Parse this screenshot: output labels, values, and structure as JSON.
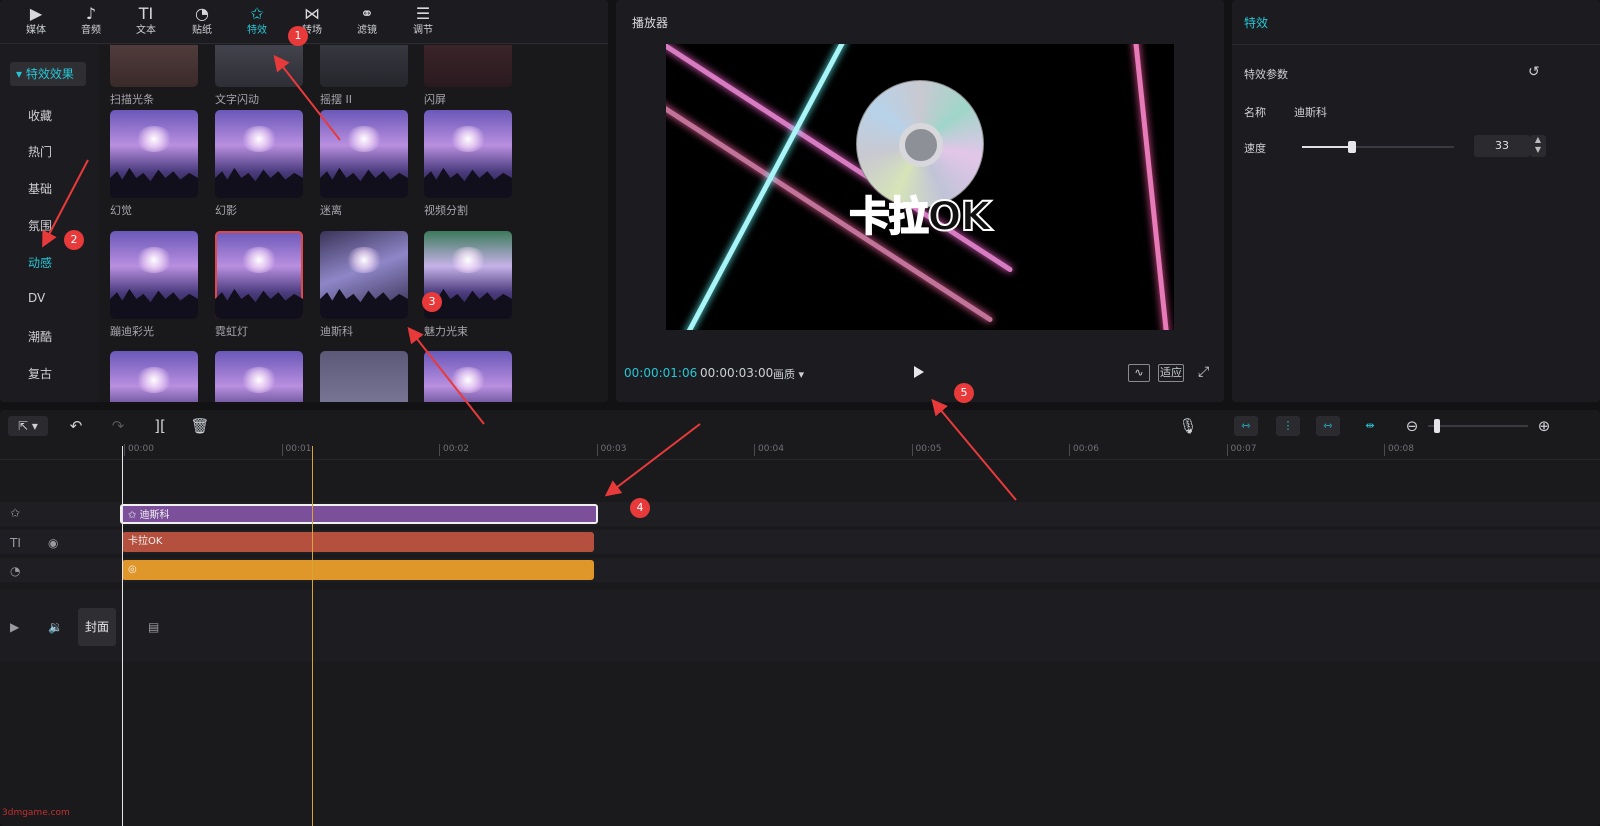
{
  "tabs": [
    {
      "label": "媒体",
      "icon": "media-icon",
      "glyph": "▶"
    },
    {
      "label": "音频",
      "icon": "audio-icon",
      "glyph": "♪"
    },
    {
      "label": "文本",
      "icon": "text-icon",
      "glyph": "TI"
    },
    {
      "label": "贴纸",
      "icon": "sticker-icon",
      "glyph": "◔"
    },
    {
      "label": "特效",
      "icon": "effects-icon",
      "glyph": "✩"
    },
    {
      "label": "转场",
      "icon": "transition-icon",
      "glyph": "⋈"
    },
    {
      "label": "滤镜",
      "icon": "filter-icon",
      "glyph": "⚭"
    },
    {
      "label": "调节",
      "icon": "adjust-icon",
      "glyph": "☰"
    }
  ],
  "categories": {
    "header": "特效效果",
    "items": [
      "收藏",
      "热门",
      "基础",
      "氛围",
      "动感",
      "DV",
      "潮酷",
      "复古"
    ],
    "active_index": 4
  },
  "effects": {
    "row0": [
      "扫描光条",
      "文字闪动",
      "摇摆 II",
      "闪屏"
    ],
    "row1": [
      "幻觉",
      "幻影",
      "迷离",
      "视频分割"
    ],
    "row2": [
      "蹦迪彩光",
      "霓虹灯",
      "迪斯科",
      "魅力光束"
    ]
  },
  "player": {
    "title": "播放器",
    "current_time": "00:00:01:06",
    "total_time": "00:00:03:00",
    "quality": "画质",
    "fit_label": "适应",
    "overlay_text": "卡拉OK"
  },
  "props": {
    "title": "特效",
    "section": "特效参数",
    "name_label": "名称",
    "name_value": "迪斯科",
    "speed_label": "速度",
    "speed_value": "33",
    "speed_fraction": 0.33
  },
  "ruler": [
    "00:00",
    "00:01",
    "00:02",
    "00:03",
    "00:04",
    "00:05",
    "00:06",
    "00:07",
    "00:08"
  ],
  "clips": {
    "effect": "迪斯科",
    "text": "卡拉OK"
  },
  "cover_label": "封面",
  "badges": [
    "1",
    "2",
    "3",
    "4",
    "5"
  ],
  "watermark": "3dmgame.com",
  "colors": {
    "accent": "#27c6d6",
    "effect_clip": "#7b4f9a",
    "text_clip": "#b5503f",
    "sticker_clip": "#e0972a",
    "annotation": "#e83a3a"
  }
}
